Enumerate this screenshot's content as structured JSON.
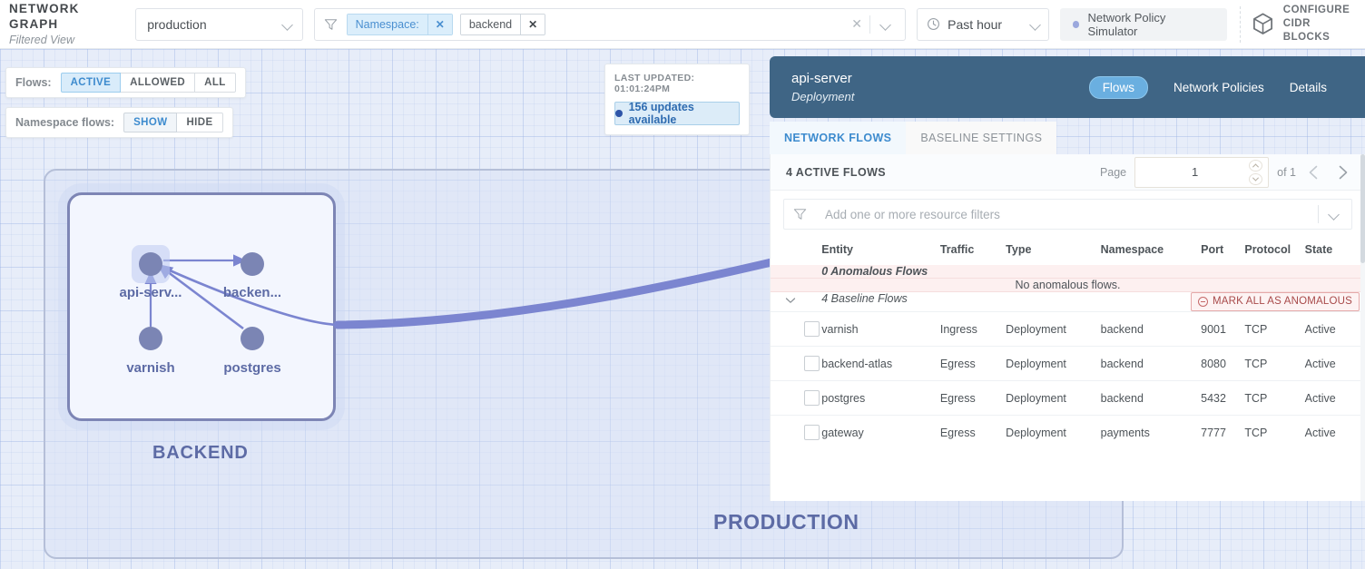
{
  "header": {
    "brand_title": "NETWORK GRAPH",
    "brand_subtitle": "Filtered View",
    "cluster_select": {
      "value": "production",
      "icon": "chevron-down-icon"
    },
    "filter": {
      "icon": "filter-funnel-icon",
      "chips": [
        {
          "label": "Namespace:",
          "remove": "✕",
          "style": "key"
        },
        {
          "label": "backend",
          "remove": "✕",
          "style": "value"
        }
      ],
      "clear_all": "✕",
      "expand": "chevron-down-icon"
    },
    "time_range": {
      "icon": "clock-icon",
      "value": "Past hour"
    },
    "policy_simulator": {
      "label": "Network Policy Simulator",
      "dot_color": "#9ba8dd"
    },
    "configure_cidr": {
      "icon": "cube-icon",
      "line1": "CONFIGURE",
      "line2": "CIDR BLOCKS"
    }
  },
  "graph_controls": {
    "flows": {
      "caption": "Flows:",
      "options": [
        "ACTIVE",
        "ALLOWED",
        "ALL"
      ],
      "selected": "ACTIVE"
    },
    "namespace_flows": {
      "caption": "Namespace flows:",
      "options": [
        "SHOW",
        "HIDE"
      ],
      "selected": "SHOW"
    }
  },
  "updates_card": {
    "last_updated_label": "LAST UPDATED: 01:01:24PM",
    "button_label": "156 updates available",
    "dot_color": "#2e55a8"
  },
  "graph": {
    "cluster_label": "PRODUCTION",
    "namespace_label": "BACKEND",
    "nodes": [
      {
        "id": "api-server",
        "label": "api-serv...",
        "selected": true
      },
      {
        "id": "backend-atlas",
        "label": "backen...",
        "selected": false
      },
      {
        "id": "varnish",
        "label": "varnish",
        "selected": false
      },
      {
        "id": "postgres",
        "label": "postgres",
        "selected": false
      }
    ],
    "edge_color": "#7b85d0"
  },
  "panel": {
    "entity_name": "api-server",
    "entity_kind": "Deployment",
    "header_color": "#3f6585",
    "tabs": [
      {
        "label": "Flows",
        "active": true
      },
      {
        "label": "Network Policies",
        "active": false
      },
      {
        "label": "Details",
        "active": false
      }
    ],
    "sub_tabs": [
      {
        "label": "NETWORK FLOWS",
        "active": true
      },
      {
        "label": "BASELINE SETTINGS",
        "active": false
      }
    ],
    "pager": {
      "count_label": "4 ACTIVE FLOWS",
      "page_label": "Page",
      "page_value": "1",
      "of_label": "of 1",
      "prev_icon": "chevron-left-icon",
      "next_icon": "chevron-right-icon"
    },
    "resource_filter": {
      "icon": "filter-funnel-icon",
      "placeholder": "Add one or more resource filters",
      "expand_icon": "chevron-down-icon"
    },
    "table": {
      "columns": [
        "Entity",
        "Traffic",
        "Type",
        "Namespace",
        "Port",
        "Protocol",
        "State"
      ],
      "anomalous_group_label": "0 Anomalous Flows",
      "anomalous_empty_text": "No anomalous flows.",
      "baseline_group_label": "4 Baseline Flows",
      "mark_all_label": "MARK ALL AS ANOMALOUS",
      "rows": [
        {
          "entity": "varnish",
          "traffic": "Ingress",
          "type": "Deployment",
          "namespace": "backend",
          "port": "9001",
          "protocol": "TCP",
          "state": "Active"
        },
        {
          "entity": "backend-atlas",
          "traffic": "Egress",
          "type": "Deployment",
          "namespace": "backend",
          "port": "8080",
          "protocol": "TCP",
          "state": "Active"
        },
        {
          "entity": "postgres",
          "traffic": "Egress",
          "type": "Deployment",
          "namespace": "backend",
          "port": "5432",
          "protocol": "TCP",
          "state": "Active"
        },
        {
          "entity": "gateway",
          "traffic": "Egress",
          "type": "Deployment",
          "namespace": "payments",
          "port": "7777",
          "protocol": "TCP",
          "state": "Active"
        }
      ]
    }
  }
}
